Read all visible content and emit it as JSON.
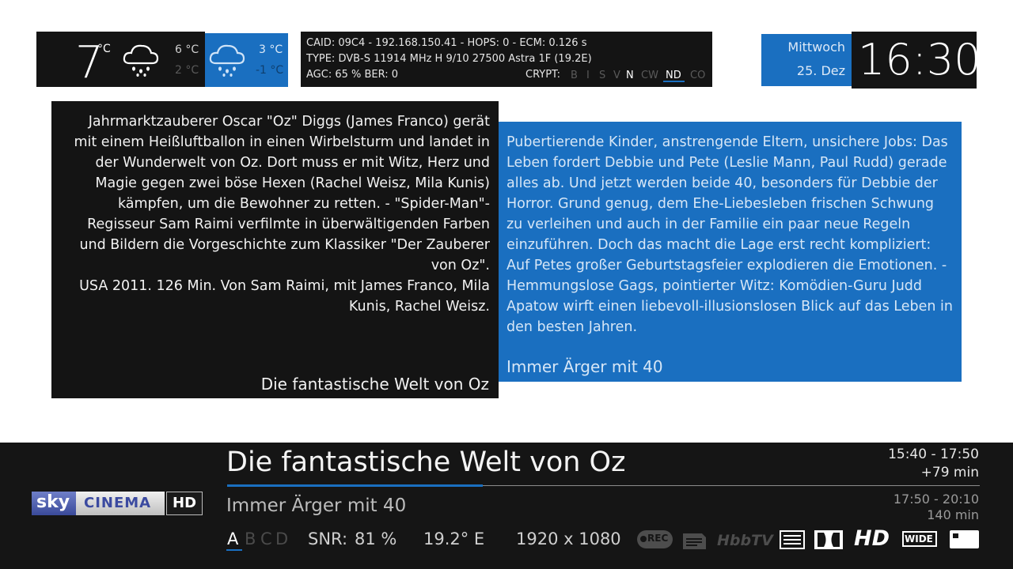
{
  "weather": {
    "current_temp": "7",
    "unit": "°C",
    "today_high": "6 °C",
    "today_low": "2 °C",
    "tomorrow_high": "3 °C",
    "tomorrow_low": "-1 °C",
    "today_icon": "rain-cloud-icon",
    "tomorrow_icon": "rain-cloud-icon"
  },
  "tuner": {
    "line1": "CAID: 09C4 - 192.168.150.41 - HOPS: 0 - ECM: 0.126 s",
    "line2": "TYPE: DVB-S  11914 MHz  H  9/10  27500 Astra 1F (19.2E)",
    "agc_ber": "AGC:  65 %  BER:  0",
    "crypt_label": "CRYPT:",
    "crypt_flags": [
      "B",
      "I",
      "S",
      "V",
      "N",
      "CW",
      "ND",
      "CO"
    ],
    "active_flags": [
      "N",
      "ND"
    ]
  },
  "datetime": {
    "weekday": "Mittwoch",
    "date": "25. Dez",
    "time": "16:30"
  },
  "epg_now": {
    "description": "Jahrmarktzauberer Oscar \"Oz\" Diggs (James Franco) gerät mit einem Heißluftballon in einen Wirbelsturm und landet in der Wunderwelt von Oz. Dort muss er mit Witz, Herz und Magie gegen zwei böse Hexen (Rachel Weisz, Mila Kunis) kämpfen, um die Bewohner zu retten. - \"Spider-Man\"-Regisseur Sam Raimi verfilmte in überwältigenden Farben und Bildern die Vorgeschichte zum Klassiker \"Der Zauberer von Oz\".",
    "credits": "USA 2011. 126 Min. Von Sam Raimi, mit James Franco, Mila Kunis, Rachel Weisz.",
    "title": "Die fantastische Welt von Oz"
  },
  "epg_next": {
    "description": "Pubertierende Kinder, anstrengende Eltern, unsichere Jobs: Das Leben fordert Debbie und Pete (Leslie Mann, Paul Rudd) gerade alles ab. Und jetzt werden beide 40, besonders für Debbie der Horror. Grund genug, dem Ehe-Liebesleben frischen Schwung zu verleihen und auch in der Familie ein paar neue Regeln einzuführen. Doch das macht die Lage erst recht kompliziert: Auf  Petes großer Geburtstagsfeier explodieren die Emotionen. - Hemmungslose Gags, pointierter Witz: Komödien-Guru Judd Apatow wirft einen liebevoll-illusionslosen Blick auf das Leben in den besten Jahren.",
    "title": "Immer Ärger mit 40"
  },
  "infobar": {
    "channel_logo": {
      "sky": "sky",
      "cinema": "CINEMA",
      "hd": "HD"
    },
    "now_title": "Die fantastische Welt von Oz",
    "now_time": "15:40 -  17:50",
    "now_remaining": "+79 min",
    "progress": 0.34,
    "next_title": "Immer Ärger mit 40",
    "next_time": "17:50 -  20:10",
    "next_duration": "140 min",
    "audio_tracks": [
      "A",
      "B",
      "C",
      "D"
    ],
    "active_track": "A",
    "snr_label": "SNR:",
    "snr_value": "81 %",
    "orbital": "19.2° E",
    "resolution": "1920 x 1080",
    "icons": [
      "rec-icon",
      "epg-doc-icon",
      "hbbtv-icon",
      "teletext-icon",
      "dolby-icon",
      "hd-icon",
      "widescreen-icon",
      "card-icon"
    ],
    "icon_labels": {
      "rec": "REC",
      "hbbtv": "HbbTV",
      "hd": "HD",
      "wide": "WIDE"
    }
  }
}
